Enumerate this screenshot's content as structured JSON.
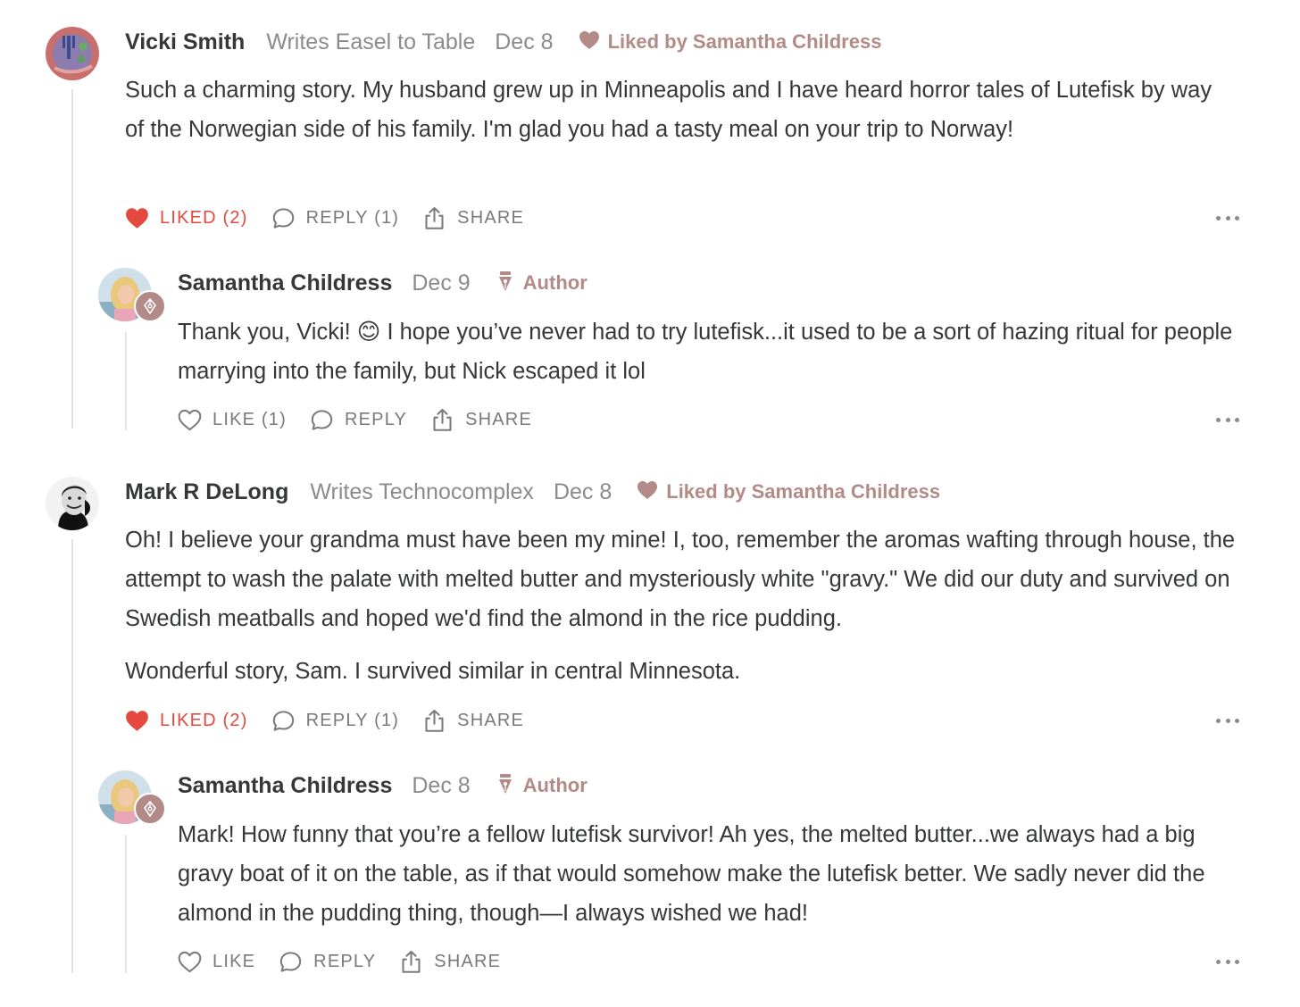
{
  "icons": {
    "heart": "heart-icon",
    "comment": "comment-bubble-icon",
    "share": "share-icon",
    "more": "more-dots-icon",
    "pen": "pen-nib-icon"
  },
  "colors": {
    "accent": "#b28a87",
    "liked": "#e5483f",
    "muted": "#8b8b8b",
    "text": "#363737"
  },
  "comments": [
    {
      "name": "Vicki Smith",
      "writes": "Writes Easel to Table",
      "date": "Dec 8",
      "liked_by": "Liked by Samantha Childress",
      "paragraphs": [
        "Such a charming story. My husband grew up in Minneapolis and I have heard horror tales of Lutefisk by way of the Norwegian side of his family. I'm glad you had a tasty meal on your trip to Norway!"
      ],
      "like_label": "LIKED (2)",
      "reply_label": "REPLY (1)",
      "share_label": "SHARE",
      "reply": {
        "name": "Samantha Childress",
        "date": "Dec 9",
        "author_label": "Author",
        "paragraphs": [
          "Thank you, Vicki! 😊 I hope you’ve never had to try lutefisk...it used to be a sort of hazing ritual for people marrying into the family, but Nick escaped it lol"
        ],
        "like_label": "LIKE (1)",
        "reply_label": "REPLY",
        "share_label": "SHARE"
      }
    },
    {
      "name": "Mark R DeLong",
      "writes": "Writes Technocomplex",
      "date": "Dec 8",
      "liked_by": "Liked by Samantha Childress",
      "paragraphs": [
        "Oh! I believe your grandma must have been my mine! I, too, remember the aromas wafting through house, the attempt to wash the palate with melted butter and mysteriously white \"gravy.\" We did our duty and survived on Swedish meatballs and hoped we'd find the almond in the rice pudding.",
        "Wonderful story, Sam. I survived similar in central Minnesota."
      ],
      "like_label": "LIKED (2)",
      "reply_label": "REPLY (1)",
      "share_label": "SHARE",
      "reply": {
        "name": "Samantha Childress",
        "date": "Dec 8",
        "author_label": "Author",
        "paragraphs": [
          "Mark! How funny that you’re a fellow lutefisk survivor! Ah yes, the melted butter...we always had a big gravy boat of it on the table, as if that would somehow make the lutefisk better. We sadly never did the almond in the pudding thing, though—I always wished we had!"
        ],
        "like_label": "LIKE",
        "reply_label": "REPLY",
        "share_label": "SHARE"
      }
    }
  ]
}
